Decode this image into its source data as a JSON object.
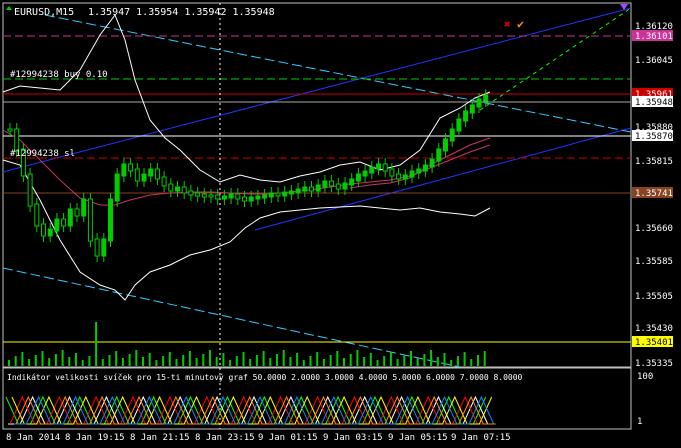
{
  "header": {
    "title": "EURUSD,M15",
    "ohlc": "1.35947 1.35954 1.35942 1.35948"
  },
  "orders": {
    "buy_label": "#12994238 buy 0.10",
    "sl_label": "#12994238 sl"
  },
  "price_axis": {
    "ticks": [
      "1.36120",
      "1.36045",
      "1.35880",
      "1.35815",
      "1.35660",
      "1.35585",
      "1.35505",
      "1.35430",
      "1.35335"
    ],
    "tags": [
      {
        "text": "1.36101",
        "bg": "#cc3399",
        "fg": "#ffffff"
      },
      {
        "text": "1.35961",
        "bg": "#cc0000",
        "fg": "#ffffff"
      },
      {
        "text": "1.35948",
        "bg": "#ffffff",
        "fg": "#000000"
      },
      {
        "text": "1.35870",
        "bg": "#ffffff",
        "fg": "#000000"
      },
      {
        "text": "1.35741",
        "bg": "#884422",
        "fg": "#ffffff"
      },
      {
        "text": "1.35401",
        "bg": "#ffff00",
        "fg": "#000000"
      }
    ]
  },
  "time_axis": {
    "labels": [
      "8 Jan 2014",
      "8 Jan 19:15",
      "8 Jan 21:15",
      "8 Jan 23:15",
      "9 Jan 01:15",
      "9 Jan 03:15",
      "9 Jan 05:15",
      "9 Jan 07:15"
    ]
  },
  "indicator": {
    "title": "Indikátor velikosti svíček pro 15-ti minutový graf 50.0000 2.0000 3.0000 4.0000 5.0000 6.0000 7.0000 8.0000",
    "scale_top": "100",
    "scale_bottom": "1"
  },
  "markers": {
    "close_mark": "✖",
    "check_mark": "✔"
  },
  "colors": {
    "background": "#000000",
    "frame": "#c0c0c0",
    "bull": "#00cc00",
    "bear": "#000000",
    "wick": "#00cc00",
    "bands": "#ffffff",
    "ma": "#cc3366",
    "volume": "#00cc00",
    "channel_blue": "#2233ff",
    "channel_cyan": "#33ccff",
    "green_dash": "#00ff00"
  }
}
